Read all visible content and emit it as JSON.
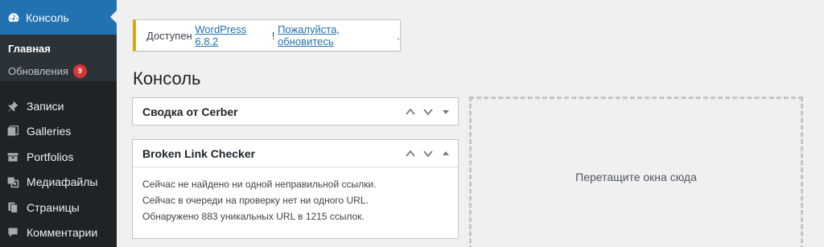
{
  "sidebar": {
    "current": {
      "label": "Консоль",
      "icon": "dashboard-icon"
    },
    "submenu": [
      {
        "label": "Главная",
        "current": true
      },
      {
        "label": "Обновления",
        "badge": "9"
      }
    ],
    "items": [
      {
        "label": "Записи",
        "icon": "pin-icon"
      },
      {
        "label": "Galleries",
        "icon": "gallery-icon"
      },
      {
        "label": "Portfolios",
        "icon": "portfolio-icon"
      },
      {
        "label": "Медиафайлы",
        "icon": "media-icon"
      },
      {
        "label": "Страницы",
        "icon": "page-icon"
      },
      {
        "label": "Комментарии",
        "icon": "comment-icon"
      }
    ]
  },
  "notice": {
    "prefix": "Доступен ",
    "link1": "WordPress 6.8.2",
    "sep": "! ",
    "link2": "Пожалуйста, обновитесь",
    "suffix": ".",
    "accent": "#dba617"
  },
  "page": {
    "title": "Консоль"
  },
  "widgets": [
    {
      "title": "Сводка от Cerber",
      "collapsed": true
    },
    {
      "title": "Broken Link Checker",
      "collapsed": false,
      "lines": [
        "Сейчас не найдено ни одной неправильной ссылки.",
        "Сейчас в очереди на проверку нет ни одного URL.",
        "Обнаружено 883 уникальных URL в 1215 ссылок."
      ]
    }
  ],
  "dropzone": {
    "label": "Перетащите окна сюда"
  },
  "colors": {
    "sidebar_bg": "#1d2327",
    "accent": "#2271b1",
    "badge": "#d63638"
  }
}
